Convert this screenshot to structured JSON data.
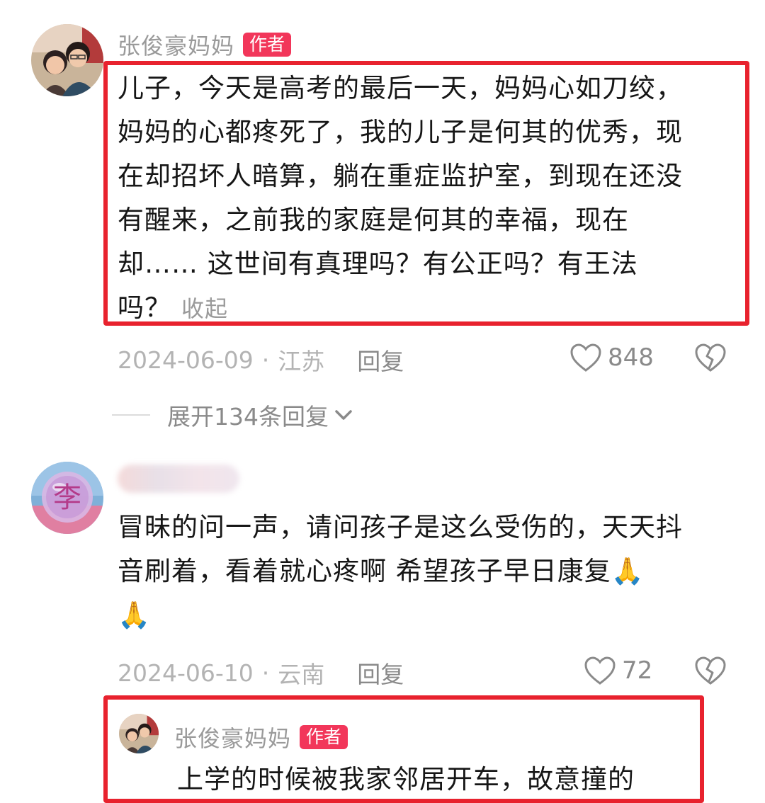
{
  "comments": [
    {
      "username": "张俊豪妈妈",
      "badge": "作者",
      "lines": [
        "儿子，今天是高考的最后一天，妈妈心如刀绞，",
        "妈妈的心都疼死了，我的儿子是何其的优秀，现",
        "在却招坏人暗算，躺在重症监护室，到现在还没",
        "有醒来，之前我的家庭是何其的幸福，现在",
        "却…… 这世间有真理吗？有公正吗？有王法",
        "吗？"
      ],
      "collapse_label": "收起",
      "date": "2024-06-09",
      "location": "江苏",
      "reply_label": "回复",
      "likes": "848"
    },
    {
      "username": "",
      "lines": [
        "冒昧的问一声，请问孩子是这么受伤的，天天抖",
        "音刷着，看着就心疼啊  希望孩子早日康复🙏",
        "🙏"
      ],
      "date": "2024-06-10",
      "location": "云南",
      "reply_label": "回复",
      "likes": "72"
    }
  ],
  "expand_replies_label": "展开134条回复",
  "reply": {
    "username": "张俊豪妈妈",
    "badge": "作者",
    "partial_text": "上学的时候被我家邻居开车，故意撞的"
  },
  "colors": {
    "highlight_box": "#e8222e",
    "author_badge": "#f2365a",
    "secondary_text": "#9a9a9a"
  },
  "icons": [
    "heart-icon",
    "broken-heart-icon",
    "chevron-down-icon",
    "avatar-photo",
    "avatar-li"
  ]
}
